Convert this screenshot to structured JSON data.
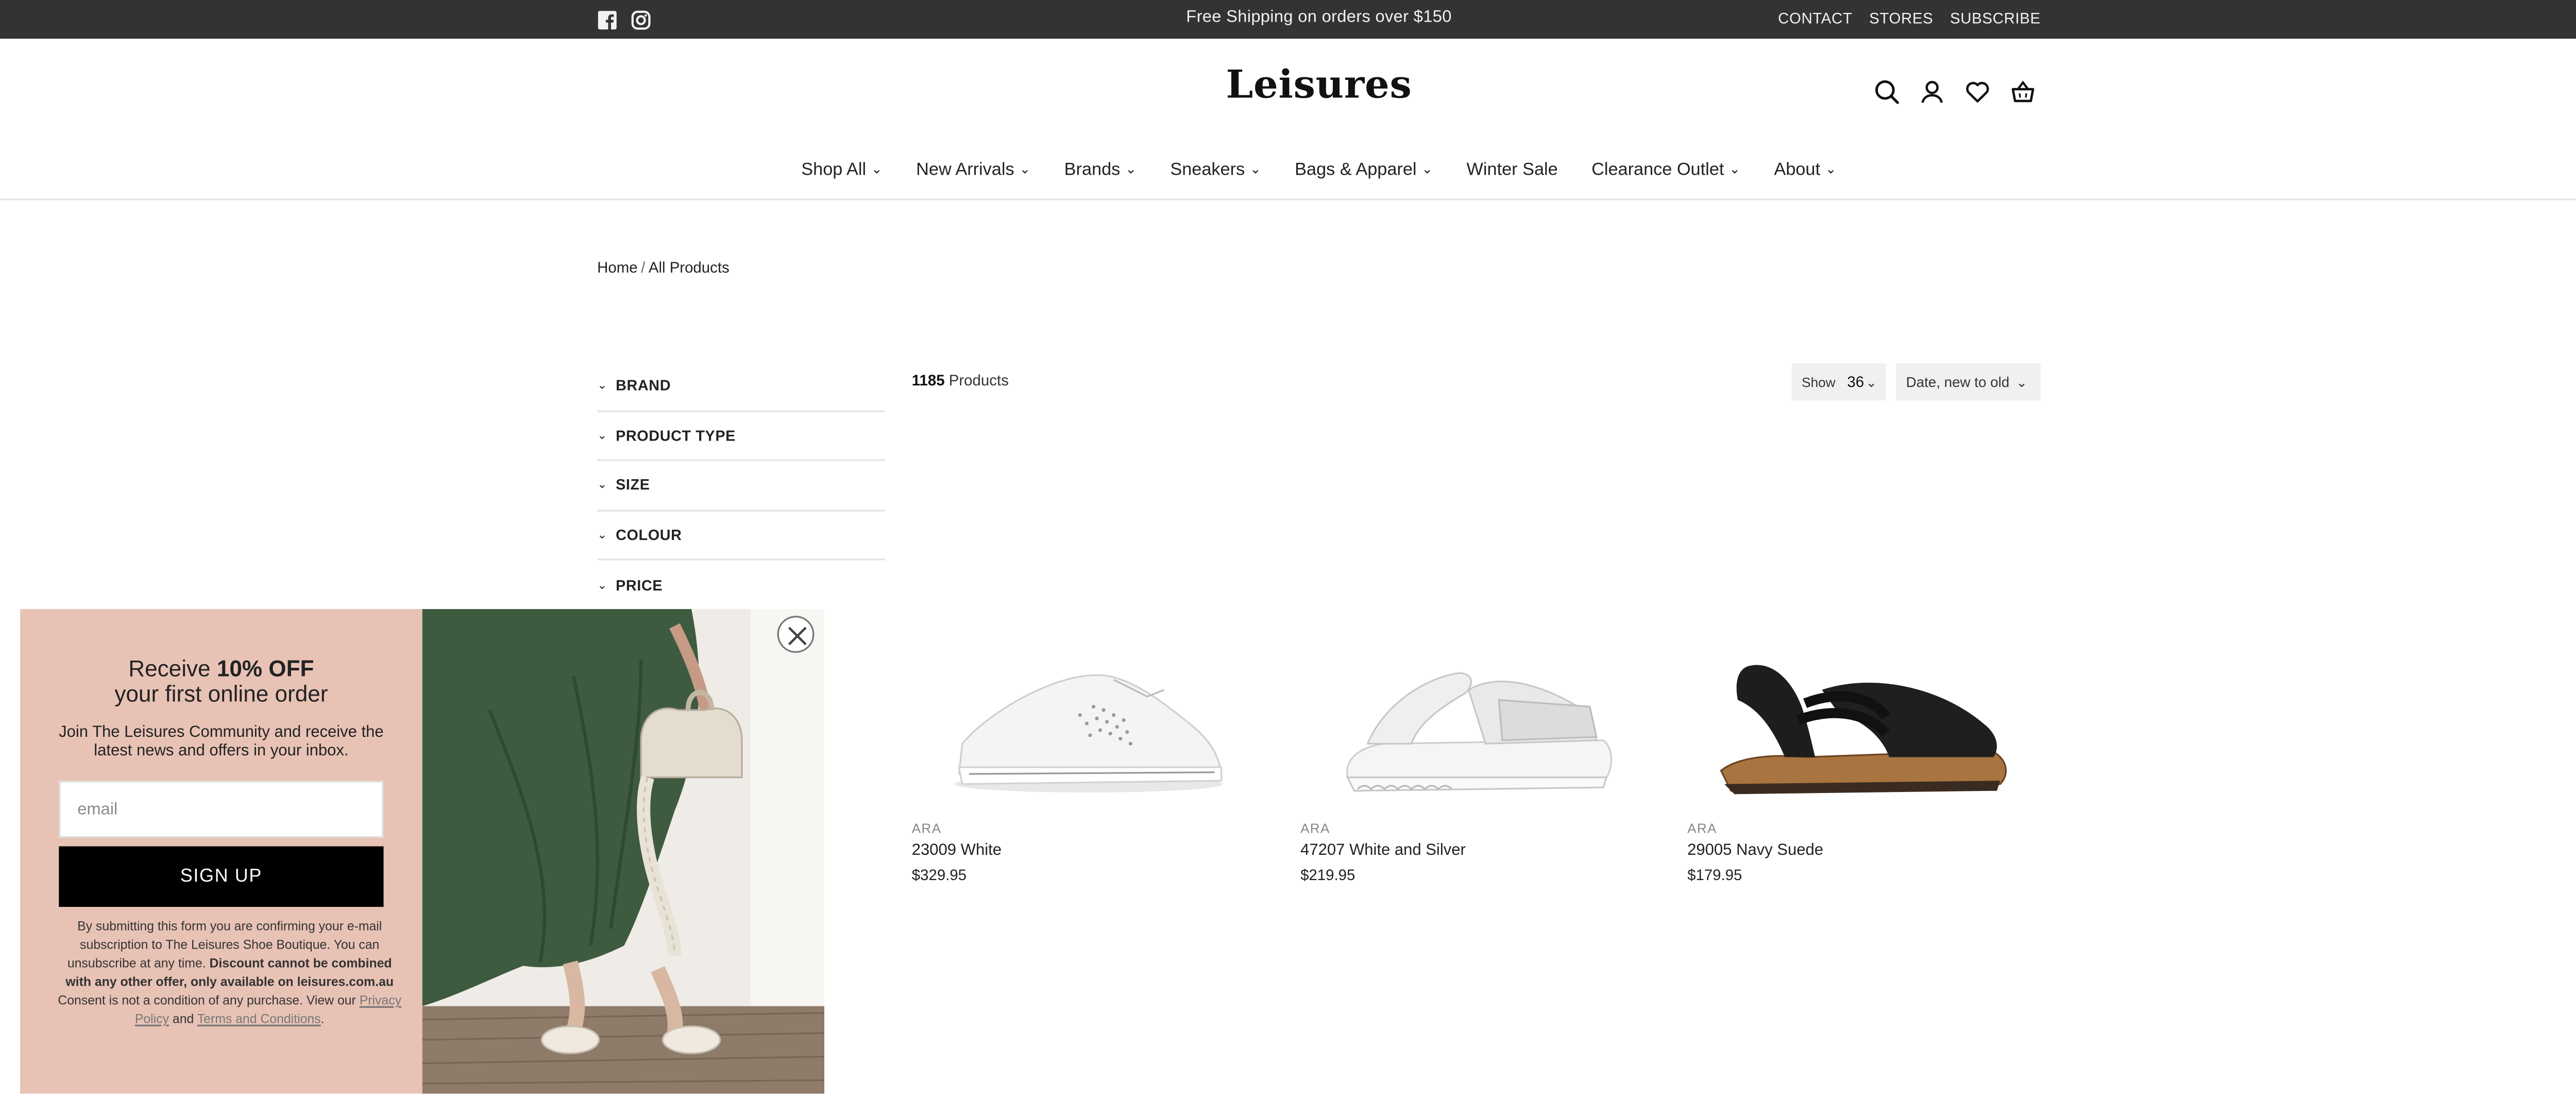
{
  "topbar": {
    "promo": "Free Shipping on orders over $150",
    "links": [
      "CONTACT",
      "STORES",
      "SUBSCRIBE"
    ],
    "social_icons": [
      "facebook-icon",
      "instagram-icon"
    ]
  },
  "header": {
    "logo": "Leisures",
    "icons": [
      "search-icon",
      "account-icon",
      "wishlist-icon",
      "cart-icon"
    ]
  },
  "nav": {
    "items": [
      {
        "label": "Shop All",
        "dropdown": true
      },
      {
        "label": "New Arrivals",
        "dropdown": true
      },
      {
        "label": "Brands",
        "dropdown": true
      },
      {
        "label": "Sneakers",
        "dropdown": true
      },
      {
        "label": "Bags & Apparel",
        "dropdown": true
      },
      {
        "label": "Winter Sale",
        "dropdown": false
      },
      {
        "label": "Clearance Outlet",
        "dropdown": true
      },
      {
        "label": "About",
        "dropdown": true
      }
    ]
  },
  "breadcrumb": {
    "home": "Home",
    "separator": "/",
    "current": "All Products"
  },
  "filters": [
    "BRAND",
    "PRODUCT TYPE",
    "SIZE",
    "COLOUR",
    "PRICE"
  ],
  "listing": {
    "count": "1185",
    "count_label": "Products",
    "show_label": "Show",
    "show_value": "36",
    "sort_value": "Date, new to old"
  },
  "products": [
    {
      "brand": "ARA",
      "name": "23009 White",
      "price": "$329.95"
    },
    {
      "brand": "ARA",
      "name": "47207 White and Silver",
      "price": "$219.95"
    },
    {
      "brand": "ARA",
      "name": "29005 Navy Suede",
      "price": "$179.95"
    }
  ],
  "popup": {
    "headline_pre": "Receive ",
    "headline_bold": "10% OFF",
    "headline_line2": "your first online order",
    "subtext": "Join The Leisures Community and receive the latest news and offers in your inbox.",
    "email_placeholder": "email",
    "button": "SIGN UP",
    "legal_1": "By submitting this form you are confirming your e-mail subscription to The Leisures Shoe Boutique. You can unsubscribe at any time. ",
    "legal_bold": "Discount cannot be combined with any other offer, only available on leisures.com.au",
    "legal_2": " Consent is not a condition of any purchase. View our ",
    "privacy_link": "Privacy Policy",
    "and": " and ",
    "terms_link": "Terms and Conditions",
    "end": "."
  }
}
